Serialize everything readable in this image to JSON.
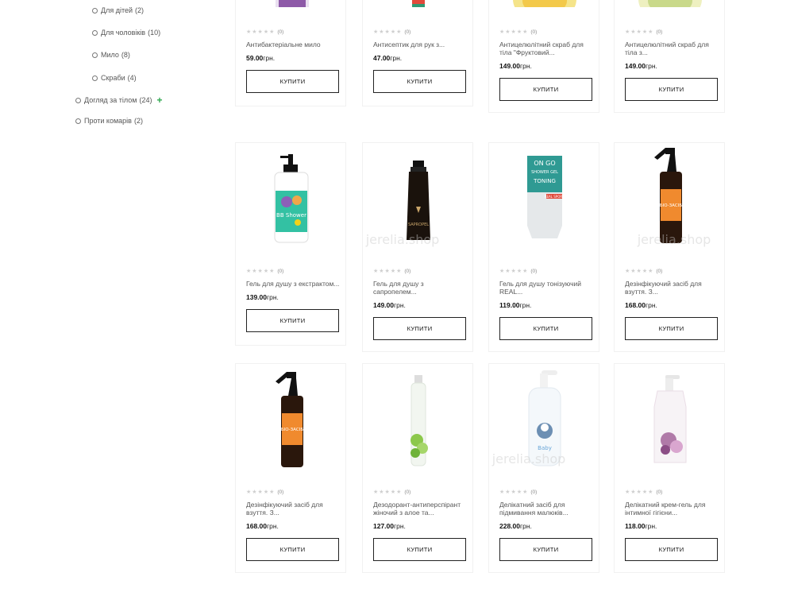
{
  "filters": [
    {
      "label": "Для дітей",
      "count": "(2)"
    },
    {
      "label": "Для чоловіків",
      "count": "(10)"
    },
    {
      "label": "Мило",
      "count": "(8)"
    },
    {
      "label": "Скраби",
      "count": "(4)"
    },
    {
      "label": "Догляд за тілом",
      "count": "(24)",
      "expand": "+"
    },
    {
      "label": "Проти комарів",
      "count": "(2)"
    }
  ],
  "stars": "★★★★★",
  "currency": "грн.",
  "buy_label": "КУПИТИ",
  "watermark": "jerelia.shop",
  "products": [
    {
      "name": "Антибактеріальне мило",
      "rating_count": "(0)",
      "price": "59.00"
    },
    {
      "name": "Антисептик для рук з...",
      "rating_count": "(0)",
      "price": "47.00"
    },
    {
      "name": "Антицелюлітний скраб для тіла \"Фруктовий...",
      "rating_count": "(0)",
      "price": "149.00"
    },
    {
      "name": "Антицелюлітний скраб для тіла з...",
      "rating_count": "(0)",
      "price": "149.00"
    },
    {
      "name": "Гель для душу з екстрактом...",
      "rating_count": "(0)",
      "price": "139.00"
    },
    {
      "name": "Гель для душу з сапропелем...",
      "rating_count": "(0)",
      "price": "149.00"
    },
    {
      "name": "Гель для душу тонізуючий REAL...",
      "rating_count": "(0)",
      "price": "119.00"
    },
    {
      "name": "Дезінфікуючий засіб для взуття. З...",
      "rating_count": "(0)",
      "price": "168.00"
    },
    {
      "name": "Дезінфікуючий засіб для взуття. З...",
      "rating_count": "(0)",
      "price": "168.00"
    },
    {
      "name": "Дезодорант-антиперспірант жіночий з алое та...",
      "rating_count": "(0)",
      "price": "127.00"
    },
    {
      "name": "Делікатний засіб для підмивання малюків...",
      "rating_count": "(0)",
      "price": "228.00"
    },
    {
      "name": "Делікатний крем-гель для інтимної гігієни...",
      "rating_count": "(0)",
      "price": "118.00"
    }
  ],
  "product_labels": {
    "bb_shower": "BB Shower",
    "sapropel": "SAPROPEL",
    "on_go": "ON GO",
    "shower_gel": "SHOWER GEL",
    "toning": "TONING",
    "real_sport": "REAL SPORT",
    "bio_zasib": "БІО-ЗАСІБ",
    "baby": "Baby"
  }
}
